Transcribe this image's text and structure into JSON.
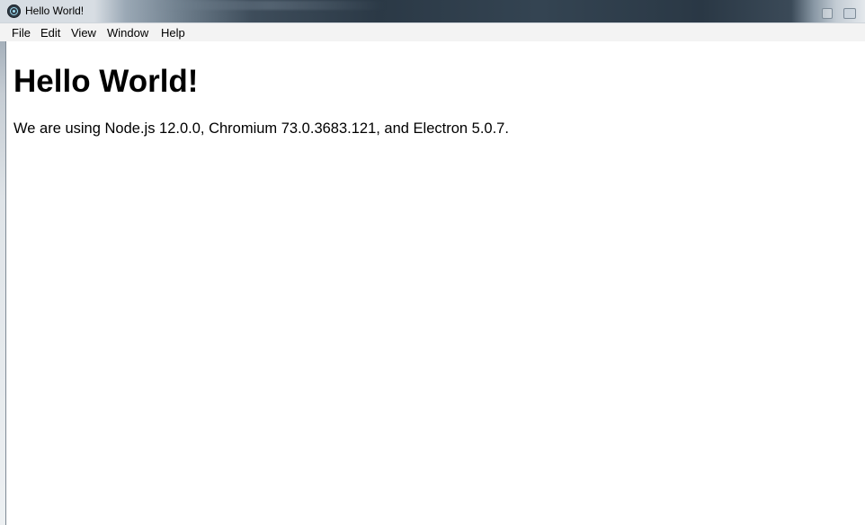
{
  "window": {
    "title": "Hello World!",
    "app_icon": "electron-icon"
  },
  "menubar": {
    "items": [
      {
        "label": "File"
      },
      {
        "label": "Edit"
      },
      {
        "label": "View"
      },
      {
        "label": "Window"
      },
      {
        "label": "Help"
      }
    ]
  },
  "content": {
    "heading": "Hello World!",
    "versions_text": "We are using Node.js 12.0.0, Chromium 73.0.3683.121, and Electron 5.0.7."
  }
}
